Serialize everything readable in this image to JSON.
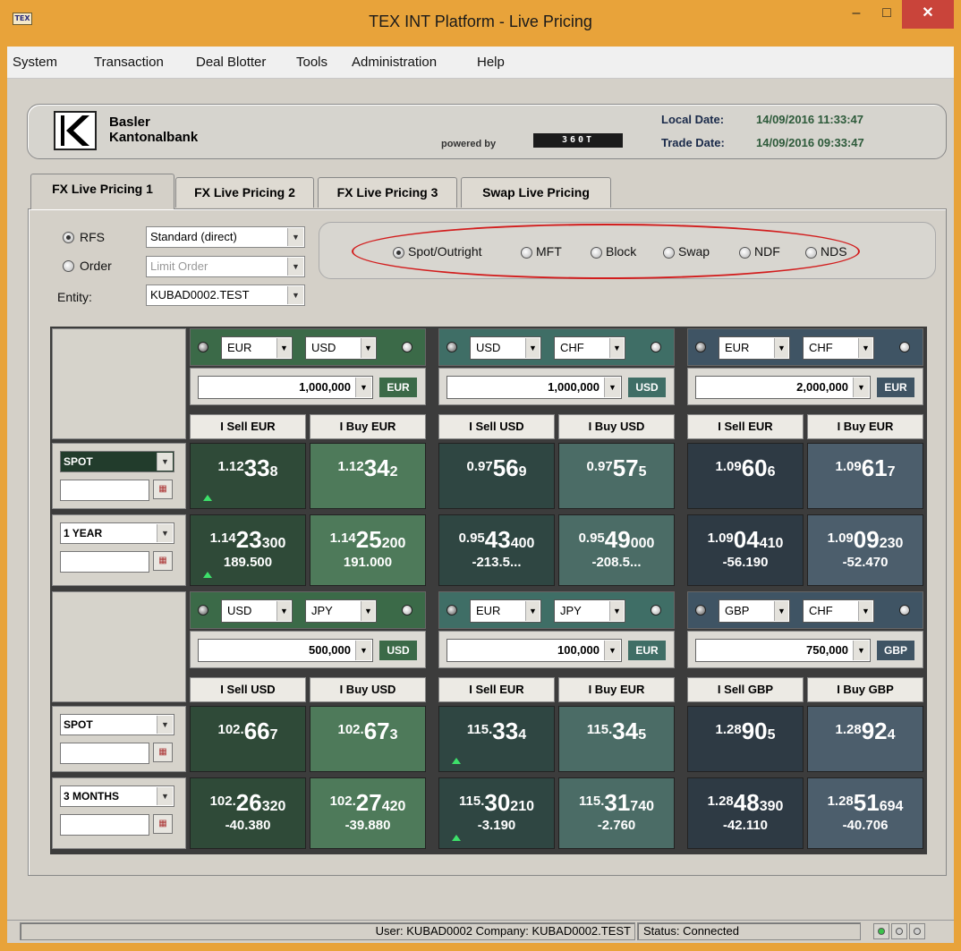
{
  "window": {
    "app_icon": "TEX",
    "title": "TEX INT Platform - Live Pricing",
    "min": "–",
    "max": "□",
    "close": "✕"
  },
  "menu": [
    "System",
    "Transaction",
    "Deal Blotter",
    "Tools",
    "Administration",
    "Help"
  ],
  "banner": {
    "bank_line1": "Basler",
    "bank_line2": "Kantonalbank",
    "powered_by": "powered by",
    "brand": "360T",
    "local_date_label": "Local Date:",
    "local_date": "14/09/2016 11:33:47",
    "trade_date_label": "Trade Date:",
    "trade_date": "14/09/2016 09:33:47"
  },
  "tabs": [
    "FX Live Pricing 1",
    "FX Live Pricing 2",
    "FX Live Pricing 3",
    "Swap Live Pricing"
  ],
  "options": {
    "rfs_label": "RFS",
    "rfs_value": "Standard (direct)",
    "order_label": "Order",
    "order_value": "Limit Order",
    "entity_label": "Entity:",
    "entity_value": "KUBAD0002.TEST"
  },
  "product_types": [
    "Spot/Outright",
    "MFT",
    "Block",
    "Swap",
    "NDF",
    "NDS"
  ],
  "tenors": [
    "SPOT",
    "1 YEAR",
    "SPOT",
    "3 MONTHS"
  ],
  "panels": [
    {
      "base": "EUR",
      "quote": "USD",
      "amount": "1,000,000",
      "amount_ccy": "EUR",
      "sell": "I Sell EUR",
      "buy": "I Buy EUR",
      "rows": [
        {
          "bid": {
            "small": "1.12",
            "big": "33",
            "pip": "8",
            "pts": ""
          },
          "ask": {
            "small": "1.12",
            "big": "34",
            "pip": "2",
            "pts": ""
          }
        },
        {
          "bid": {
            "small": "1.14",
            "big": "23",
            "pip": "300",
            "pts": "189.500"
          },
          "ask": {
            "small": "1.14",
            "big": "25",
            "pip": "200",
            "pts": "191.000"
          }
        }
      ]
    },
    {
      "base": "USD",
      "quote": "CHF",
      "amount": "1,000,000",
      "amount_ccy": "USD",
      "sell": "I Sell USD",
      "buy": "I Buy USD",
      "rows": [
        {
          "bid": {
            "small": "0.97",
            "big": "56",
            "pip": "9",
            "pts": ""
          },
          "ask": {
            "small": "0.97",
            "big": "57",
            "pip": "5",
            "pts": ""
          }
        },
        {
          "bid": {
            "small": "0.95",
            "big": "43",
            "pip": "400",
            "pts": "-213.5..."
          },
          "ask": {
            "small": "0.95",
            "big": "49",
            "pip": "000",
            "pts": "-208.5..."
          }
        }
      ]
    },
    {
      "base": "EUR",
      "quote": "CHF",
      "amount": "2,000,000",
      "amount_ccy": "EUR",
      "sell": "I Sell EUR",
      "buy": "I Buy EUR",
      "rows": [
        {
          "bid": {
            "small": "1.09",
            "big": "60",
            "pip": "6",
            "pts": ""
          },
          "ask": {
            "small": "1.09",
            "big": "61",
            "pip": "7",
            "pts": ""
          }
        },
        {
          "bid": {
            "small": "1.09",
            "big": "04",
            "pip": "410",
            "pts": "-56.190"
          },
          "ask": {
            "small": "1.09",
            "big": "09",
            "pip": "230",
            "pts": "-52.470"
          }
        }
      ]
    },
    {
      "base": "USD",
      "quote": "JPY",
      "amount": "500,000",
      "amount_ccy": "USD",
      "sell": "I Sell USD",
      "buy": "I Buy USD",
      "rows": [
        {
          "bid": {
            "small": "102.",
            "big": "66",
            "pip": "7",
            "pts": ""
          },
          "ask": {
            "small": "102.",
            "big": "67",
            "pip": "3",
            "pts": ""
          }
        },
        {
          "bid": {
            "small": "102.",
            "big": "26",
            "pip": "320",
            "pts": "-40.380"
          },
          "ask": {
            "small": "102.",
            "big": "27",
            "pip": "420",
            "pts": "-39.880"
          }
        }
      ]
    },
    {
      "base": "EUR",
      "quote": "JPY",
      "amount": "100,000",
      "amount_ccy": "EUR",
      "sell": "I Sell EUR",
      "buy": "I Buy EUR",
      "rows": [
        {
          "bid": {
            "small": "115.",
            "big": "33",
            "pip": "4",
            "pts": ""
          },
          "ask": {
            "small": "115.",
            "big": "34",
            "pip": "5",
            "pts": ""
          }
        },
        {
          "bid": {
            "small": "115.",
            "big": "30",
            "pip": "210",
            "pts": "-3.190"
          },
          "ask": {
            "small": "115.",
            "big": "31",
            "pip": "740",
            "pts": "-2.760"
          }
        }
      ]
    },
    {
      "base": "GBP",
      "quote": "CHF",
      "amount": "750,000",
      "amount_ccy": "GBP",
      "sell": "I Sell GBP",
      "buy": "I Buy GBP",
      "rows": [
        {
          "bid": {
            "small": "1.28",
            "big": "90",
            "pip": "5",
            "pts": ""
          },
          "ask": {
            "small": "1.28",
            "big": "92",
            "pip": "4",
            "pts": ""
          }
        },
        {
          "bid": {
            "small": "1.28",
            "big": "48",
            "pip": "390",
            "pts": "-42.110"
          },
          "ask": {
            "small": "1.28",
            "big": "51",
            "pip": "694",
            "pts": "-40.706"
          }
        }
      ]
    }
  ],
  "status": {
    "user": "User: KUBAD0002 Company: KUBAD0002.TEST",
    "connection": "Status:  Connected"
  },
  "colors": {
    "window_frame": "#e8a33a",
    "close": "#c9443a",
    "highlight_ellipse": "#d21d1d",
    "uptick": "#3de06a"
  }
}
